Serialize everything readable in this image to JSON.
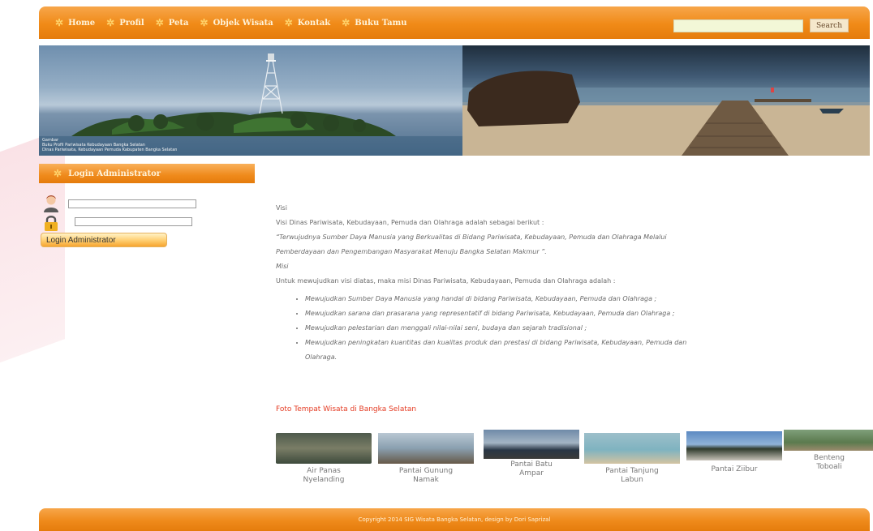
{
  "nav": {
    "items": [
      "Home",
      "Profil",
      "Peta",
      "Objek Wisata",
      "Kontak",
      "Buku Tamu"
    ],
    "search_placeholder": "",
    "search_label": "Search"
  },
  "banner": {
    "caption_lines": [
      "Gambar",
      "Buku Profil Pariwisata Kebudayaan Bangka Selatan",
      "Dinas Pariwisata, Kebudayaan Pemuda Kabupaten Bangka Selatan"
    ]
  },
  "sidebar": {
    "title": "Login Administrator",
    "username_value": "",
    "password_value": "",
    "button_label": "Login Administrator"
  },
  "content": {
    "visi_heading": "Visi",
    "visi_intro": "Visi Dinas Pariwisata, Kebudayaan, Pemuda dan Olahraga adalah sebagai berikut :",
    "visi_quote_1": "“Terwujudnya Sumber Daya Manusia yang Berkualitas di Bidang Pariwisata, Kebudayaan, Pemuda dan Olahraga Melalui",
    "visi_quote_2": "Pemberdayaan dan Pengembangan Masyarakat Menuju Bangka Selatan Makmur ”.",
    "misi_heading": "Misi",
    "misi_intro": "Untuk mewujudkan visi diatas, maka misi Dinas Pariwisata, Kebudayaan, Pemuda dan Olahraga adalah :",
    "missions": [
      "Mewujudkan Sumber Daya Manusia yang handal di bidang Pariwisata, Kebudayaan, Pemuda dan Olahraga ;",
      "Mewujudkan sarana dan prasarana yang representatif di bidang Pariwisata, Kebudayaan, Pemuda dan Olahraga ;",
      "Mewujudkan pelestarian dan menggali nilai-nilai seni, budaya dan sejarah tradisional ;",
      "Mewujudkan peningkatan kuantitas dan kualitas produk dan prestasi di bidang Pariwisata, Kebudayaan, Pemuda dan",
      "Olahraga."
    ]
  },
  "gallery": {
    "title": "Foto Tempat Wisata di Bangka Selatan",
    "items": [
      {
        "caption_1": "Air Panas",
        "caption_2": "Nyelanding"
      },
      {
        "caption_1": "Pantai Gunung",
        "caption_2": "Namak"
      },
      {
        "caption_1": "Pantai Batu",
        "caption_2": "Ampar"
      },
      {
        "caption_1": "Pantai Tanjung",
        "caption_2": "Labun"
      },
      {
        "caption_1": "Pantai Ziibur",
        "caption_2": ""
      },
      {
        "caption_1": "Benteng",
        "caption_2": "Toboali"
      }
    ]
  },
  "footer": {
    "text": "Copyright 2014 SIG Wisata Bangka Selatan, design by Dori Saprizal"
  },
  "colors": {
    "brand_orange": "#f08a17",
    "gallery_title": "#e43b23"
  }
}
